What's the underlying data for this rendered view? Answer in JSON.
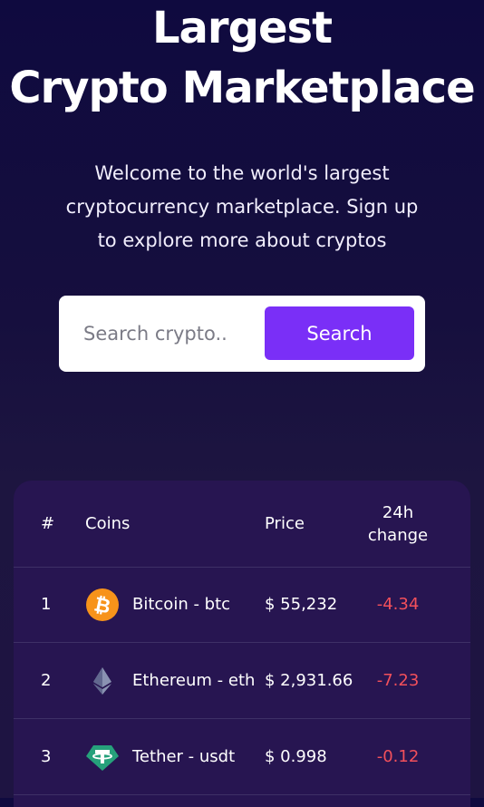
{
  "hero": {
    "title_line1": "Largest",
    "title_line2": "Crypto Marketplace",
    "subtitle": "Welcome to the world's largest cryptocurrency marketplace. Sign up to explore more about cryptos"
  },
  "search": {
    "placeholder": "Search crypto..",
    "button_label": "Search"
  },
  "table": {
    "headers": {
      "rank": "#",
      "coins": "Coins",
      "price": "Price",
      "change": "24h change"
    },
    "rows": [
      {
        "rank": "1",
        "name": "Bitcoin - btc",
        "price": "$ 55,232",
        "change": "-4.34",
        "icon": "bitcoin-icon",
        "icon_color": "#f7931a"
      },
      {
        "rank": "2",
        "name": "Ethereum - eth",
        "price": "$ 2,931.66",
        "change": "-7.23",
        "icon": "ethereum-icon",
        "icon_color": "#627eea"
      },
      {
        "rank": "3",
        "name": "Tether - usdt",
        "price": "$ 0.998",
        "change": "-0.12",
        "icon": "tether-icon",
        "icon_color": "#26a17b"
      }
    ]
  },
  "colors": {
    "accent": "#7a2ff7",
    "negative": "#f2505b",
    "table_bg": "#271551"
  }
}
